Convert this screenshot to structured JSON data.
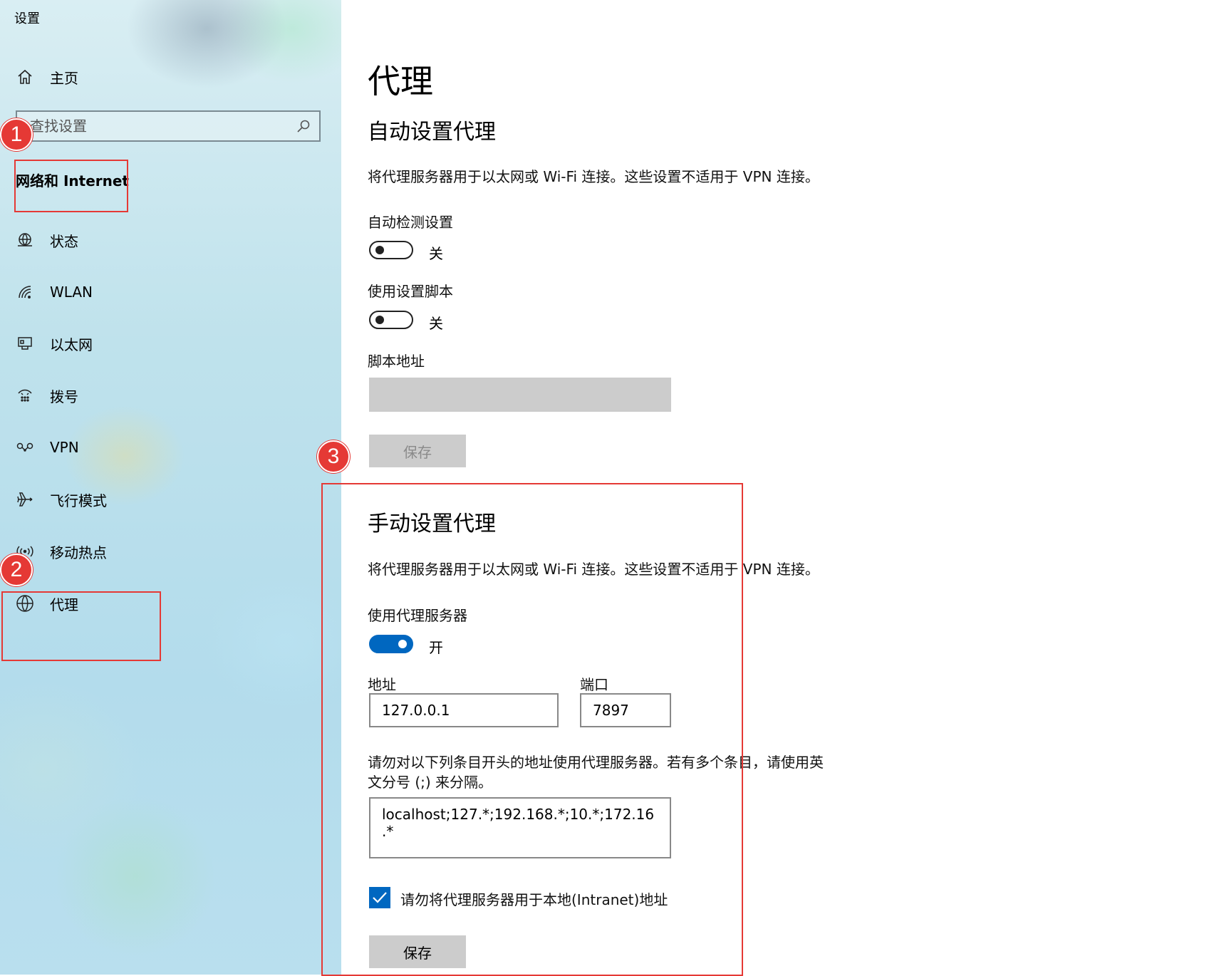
{
  "app": {
    "title": "设置"
  },
  "sidebar": {
    "home_label": "主页",
    "search_placeholder": "查找设置",
    "section_title": "网络和 Internet",
    "items": [
      {
        "label": "状态",
        "icon": "globe-status-icon"
      },
      {
        "label": "WLAN",
        "icon": "wifi-icon"
      },
      {
        "label": "以太网",
        "icon": "ethernet-icon"
      },
      {
        "label": "拨号",
        "icon": "dialup-icon"
      },
      {
        "label": "VPN",
        "icon": "vpn-icon"
      },
      {
        "label": "飞行模式",
        "icon": "airplane-icon"
      },
      {
        "label": "移动热点",
        "icon": "hotspot-icon"
      },
      {
        "label": "代理",
        "icon": "globe-icon"
      }
    ]
  },
  "annotations": {
    "badges": [
      "1",
      "2",
      "3"
    ],
    "color": "#e53935"
  },
  "main": {
    "title": "代理",
    "auto": {
      "heading": "自动设置代理",
      "description": "将代理服务器用于以太网或 Wi-Fi 连接。这些设置不适用于 VPN 连接。",
      "detect_label": "自动检测设置",
      "detect_state": "关",
      "script_label": "使用设置脚本",
      "script_state": "关",
      "script_address_label": "脚本地址",
      "save_label": "保存"
    },
    "manual": {
      "heading": "手动设置代理",
      "description": "将代理服务器用于以太网或 Wi-Fi 连接。这些设置不适用于 VPN 连接。",
      "use_proxy_label": "使用代理服务器",
      "use_proxy_state": "开",
      "address_label": "地址",
      "address_value": "127.0.0.1",
      "port_label": "端口",
      "port_value": "7897",
      "exceptions_line1": "请勿对以下列条目开头的地址使用代理服务器。若有多个条目，请使用英",
      "exceptions_line2": "文分号 (;) 来分隔。",
      "exceptions_value": "localhost;127.*;192.168.*;10.*;172.16.*",
      "bypass_local_label": "请勿将代理服务器用于本地(Intranet)地址",
      "bypass_local_checked": true,
      "save_label": "保存"
    }
  },
  "colors": {
    "accent": "#0067c0",
    "annotation": "#e53935",
    "disabled": "#cccccc"
  }
}
